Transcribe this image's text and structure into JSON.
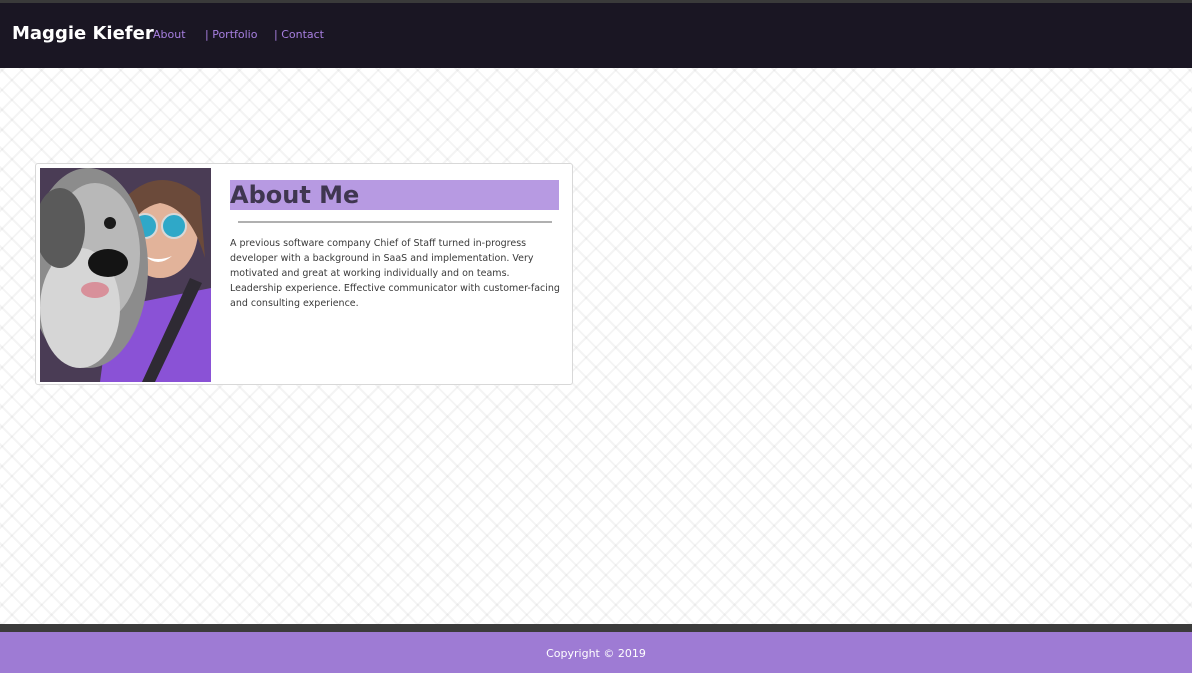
{
  "navbar": {
    "brand": "Maggie Kiefer",
    "links": [
      {
        "label": "About"
      },
      {
        "label": "| Portfolio"
      },
      {
        "label": "| Contact"
      }
    ]
  },
  "about": {
    "heading": "About Me",
    "bio": "A previous software company Chief of Staff turned in-progress developer with a background in SaaS and implementation. Very motivated and great at working individually and on teams. Leadership experience. Effective communicator with customer-facing and consulting experience.",
    "photo": "profile-photo"
  },
  "footer": {
    "copyright": "Copyright © 2019"
  },
  "colors": {
    "navbar_bg": "#1a1623",
    "accent": "#a77fe0",
    "heading_bg": "#b79ae2",
    "footer_bg": "#9e7bd4"
  }
}
